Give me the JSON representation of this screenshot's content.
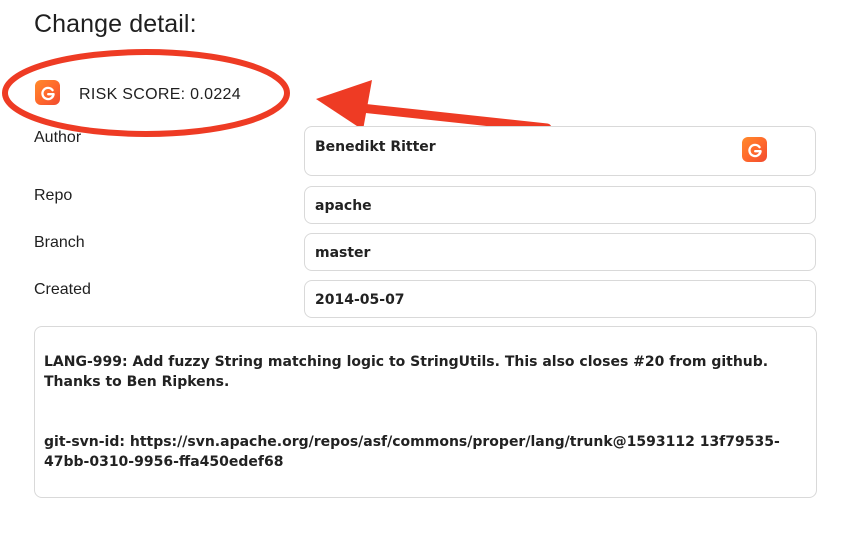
{
  "page": {
    "title": "Change detail:"
  },
  "risk": {
    "label": "RISK SCORE: 0.0224",
    "icon": "g-logo-icon",
    "accent_color": "#ff6a2c",
    "annotation_color": "#ee3b24"
  },
  "fields": {
    "author": {
      "label": "Author",
      "value": "Benedikt Ritter",
      "icon": "g-logo-icon"
    },
    "repo": {
      "label": "Repo",
      "value": "apache"
    },
    "branch": {
      "label": "Branch",
      "value": "master"
    },
    "created": {
      "label": "Created",
      "value": "2014-05-07"
    }
  },
  "message": {
    "line1": "LANG-999: Add fuzzy String matching logic to StringUtils. This also closes #20 from github. Thanks to Ben Ripkens.",
    "line2": "git-svn-id: https://svn.apache.org/repos/asf/commons/proper/lang/trunk@1593112 13f79535-47bb-0310-9956-ffa450edef68"
  }
}
